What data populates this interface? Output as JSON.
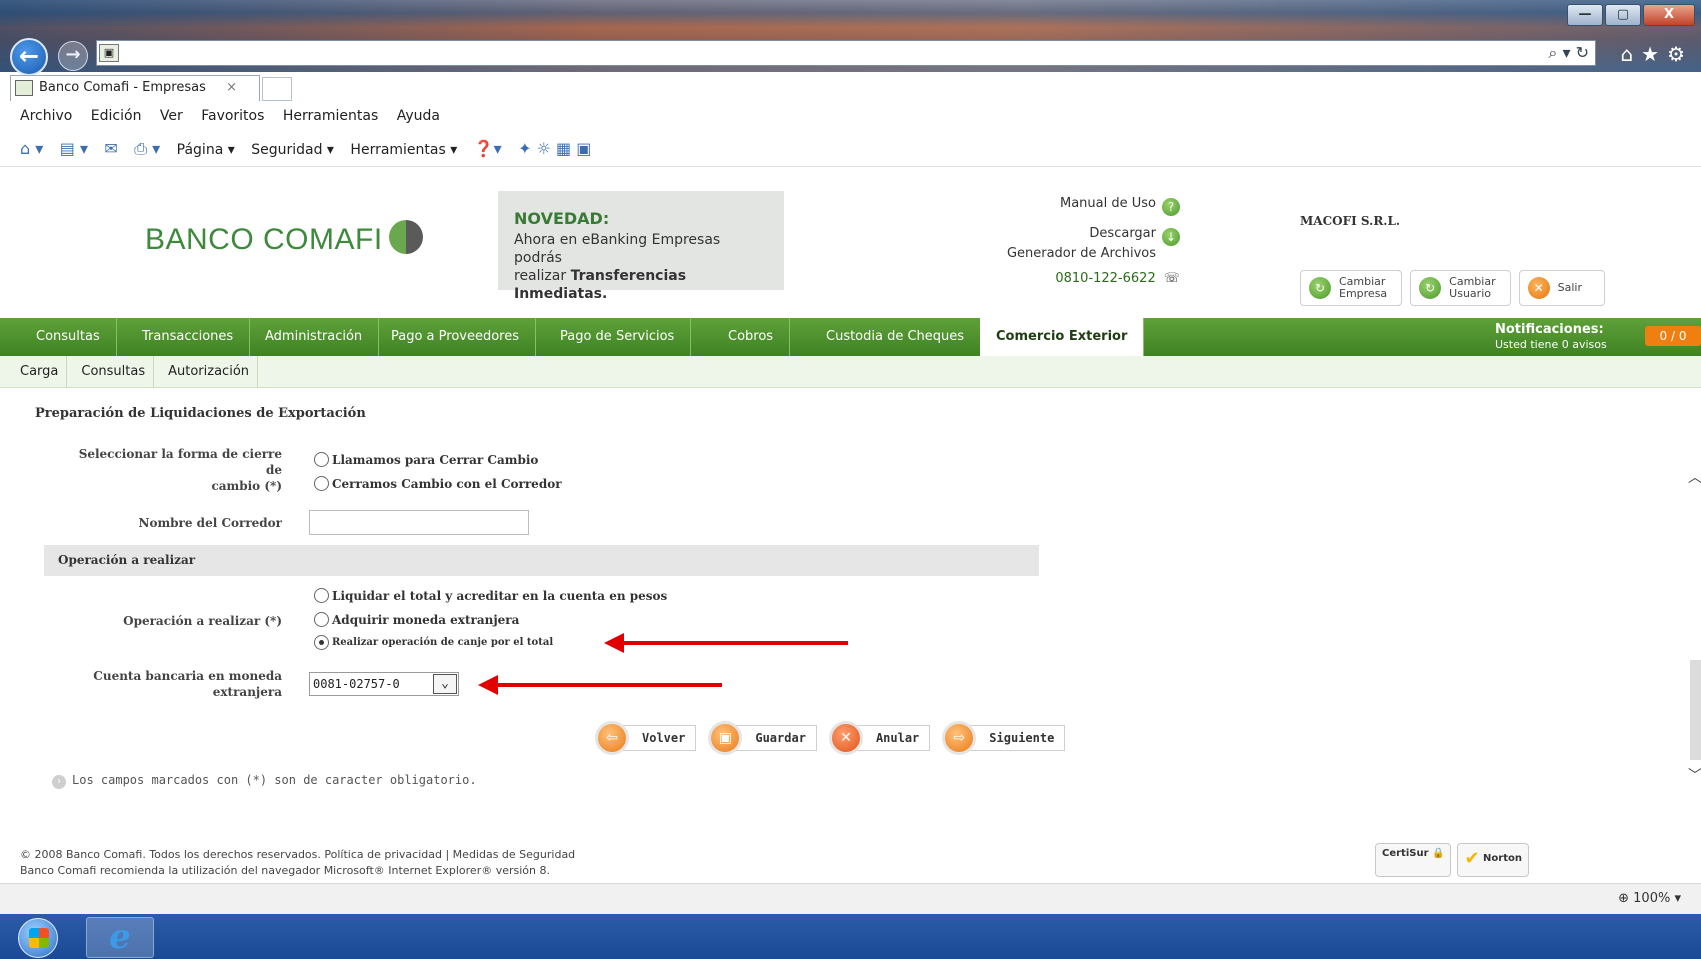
{
  "browser": {
    "tab_title": "Banco Comafi - Empresas",
    "tab_close": "×",
    "window_controls": [
      "—",
      "▢",
      "X"
    ],
    "address_tools": "⌕ ▾ ↻",
    "top_icons": "⌂★⚙",
    "menu": [
      "Archivo",
      "Edición",
      "Ver",
      "Favoritos",
      "Herramientas",
      "Ayuda"
    ],
    "command_bar": [
      "Página ▾",
      "Seguridad ▾",
      "Herramientas ▾"
    ],
    "zoom": "100%"
  },
  "header": {
    "logo_text": "BANCO COMAFI",
    "promo_title": "NOVEDAD:",
    "promo_line1": "Ahora en eBanking Empresas podrás",
    "promo_line2_prefix": "realizar ",
    "promo_line2_bold": "Transferencias Inmediatas.",
    "manual": "Manual de Uso",
    "download_line1": "Descargar",
    "download_line2": "Generador de Archivos",
    "phone": "0810-122-6622",
    "company": "MACOFI S.R.L.",
    "btn_change_company_1": "Cambiar",
    "btn_change_company_2": "Empresa",
    "btn_change_user_1": "Cambiar",
    "btn_change_user_2": "Usuario",
    "btn_exit": "Salir"
  },
  "nav": {
    "items": [
      "Consultas",
      "Transacciones",
      "Administración",
      "Pago a Proveedores",
      "Pago de Servicios",
      "Cobros",
      "Custodia de Cheques",
      "Comercio Exterior"
    ],
    "notifications_title": "Notificaciones:",
    "notifications_sub": "Usted tiene 0 avisos",
    "notifications_badge": "0 / 0",
    "sub_items": [
      "Carga",
      "Consultas",
      "Autorización"
    ]
  },
  "form": {
    "page_title": "Preparación de Liquidaciones de Exportación",
    "close_label_1": "Seleccionar la forma de cierre de",
    "close_label_2": "cambio (*)",
    "close_opt_1": "Llamamos para Cerrar Cambio",
    "close_opt_2": "Cerramos Cambio con el Corredor",
    "broker_label": "Nombre del Corredor",
    "broker_value": "",
    "section_title": "Operación a realizar",
    "operation_label": "Operación a realizar (*)",
    "op_1": "Liquidar el total y acreditar en la cuenta en pesos",
    "op_2": "Adquirir moneda extranjera",
    "op_3": "Realizar operación de canje por el total",
    "op_selected": 3,
    "account_label_1": "Cuenta bancaria en moneda",
    "account_label_2": "extranjera",
    "account_value": "0081-02757-0",
    "buttons": [
      "Volver",
      "Guardar",
      "Anular",
      "Siguiente"
    ],
    "note": "Los campos marcados con (*) son de caracter obligatorio."
  },
  "footer": {
    "line1": "© 2008 Banco Comafi. Todos los derechos reservados. Política de privacidad  | Medidas de Seguridad",
    "line2": "Banco Comafi recomienda la utilización del navegador Microsoft® Internet Explorer® versión 8.",
    "seal_1": "CertiSur",
    "seal_2": "Norton"
  },
  "colors": {
    "brand_green": "#4a8f2c",
    "accent_orange": "#ea7b18",
    "annotation_red": "#e10000"
  }
}
